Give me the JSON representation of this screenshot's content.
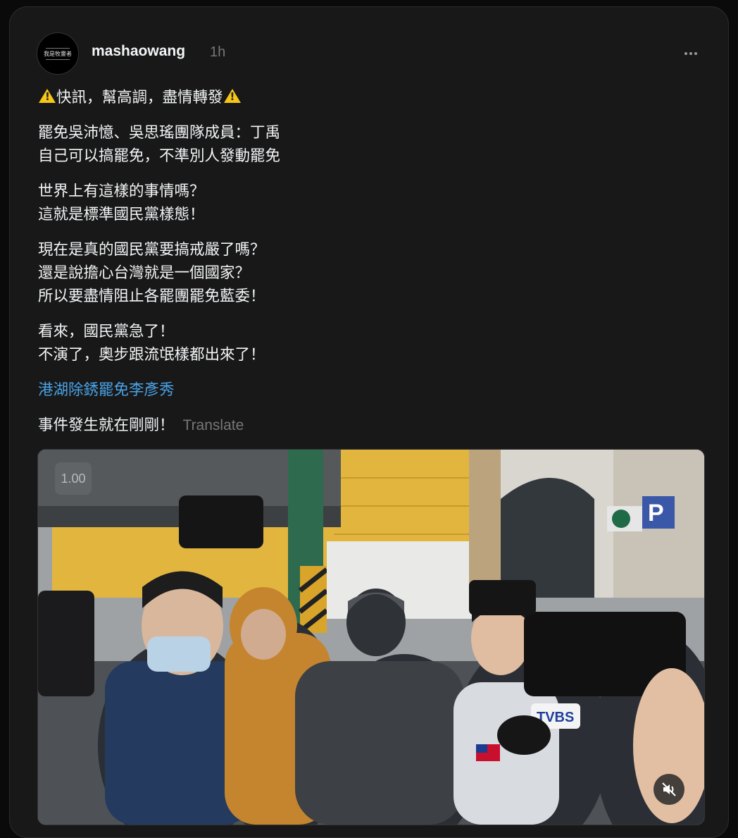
{
  "post": {
    "username": "mashaowang",
    "timestamp": "1h",
    "avatar_text": "我是牧靈者",
    "body": {
      "p1": "快訊，幫高調，盡情轉發",
      "p2_l1": "罷免吳沛憶、吳思瑤團隊成員：丁禹",
      "p2_l2": "自己可以搞罷免，不準別人發動罷免",
      "p3_l1": "世界上有這樣的事情嗎？",
      "p3_l2": "這就是標準國民黨樣態！",
      "p4_l1": "現在是真的國民黨要搞戒嚴了嗎？",
      "p4_l2": "還是說擔心台灣就是一個國家？",
      "p4_l3": "所以要盡情阻止各罷團罷免藍委！",
      "p5_l1": "看來，國民黨急了！",
      "p5_l2": "不演了，奧步跟流氓樣都出來了！",
      "tag": "港湖除銹罷免李彥秀",
      "last": "事件發生就在剛剛！",
      "translate": "Translate"
    },
    "video": {
      "speed": "1.00",
      "sign_p": "P",
      "sign_tvbs": "TVBS"
    }
  },
  "icons": {
    "warning": "warning-icon",
    "more": "more-icon",
    "mute": "speaker-muted-icon"
  },
  "colors": {
    "link": "#4aa3e8",
    "warning": "#f5c518",
    "card_bg": "#181818"
  }
}
